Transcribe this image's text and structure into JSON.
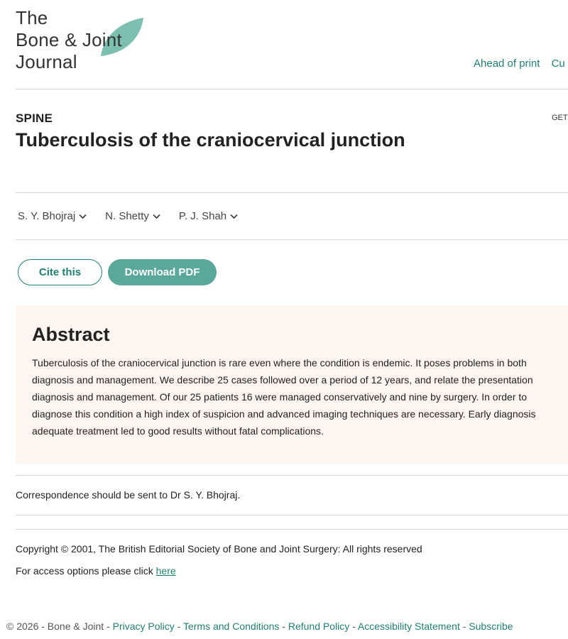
{
  "logo": {
    "line1": "The",
    "line2": "Bone & Joint",
    "line3": "Journal"
  },
  "topnav": {
    "items": [
      "Ahead of print",
      "Cu"
    ]
  },
  "article": {
    "section": "SPINE",
    "get_label": "GET",
    "title": "Tuberculosis of the craniocervical junction",
    "authors": [
      "S. Y. Bhojraj",
      "N. Shetty",
      "P. J. Shah"
    ]
  },
  "actions": {
    "cite_label": "Cite this",
    "pdf_label": "Download PDF"
  },
  "abstract": {
    "heading": "Abstract",
    "lines": [
      "Tuberculosis of the craniocervical junction is rare even where the condition is endemic. It poses problems in both",
      "diagnosis and management. We describe 25 cases followed over a period of 12 years, and relate the presentation",
      "diagnosis and management. Of our 25 patients 16 were managed conservatively and nine by surgery. In order to",
      "diagnose this condition a high index of suspicion and advanced imaging techniques are necessary. Early diagnosis",
      "adequate treatment led to good results without fatal complications."
    ]
  },
  "correspondence": "Correspondence should be sent to Dr S. Y. Bhojraj.",
  "copyright": "Copyright © 2001, The British Editorial Society of Bone and Joint Surgery: All rights reserved",
  "access": {
    "prefix": "For access options please click ",
    "link": "here"
  },
  "footer": {
    "copyright": "© 2026 - Bone & Joint",
    "separator": " - ",
    "links": [
      "Privacy Policy",
      "Terms and Conditions",
      "Refund Policy",
      "Accessibility Statement",
      "Subscribe"
    ]
  },
  "colors": {
    "accent": "#1f7f72",
    "button_fill": "#5aa89b",
    "leaf": "#7cbfb0",
    "abstract_bg": "#fdf5ef"
  }
}
